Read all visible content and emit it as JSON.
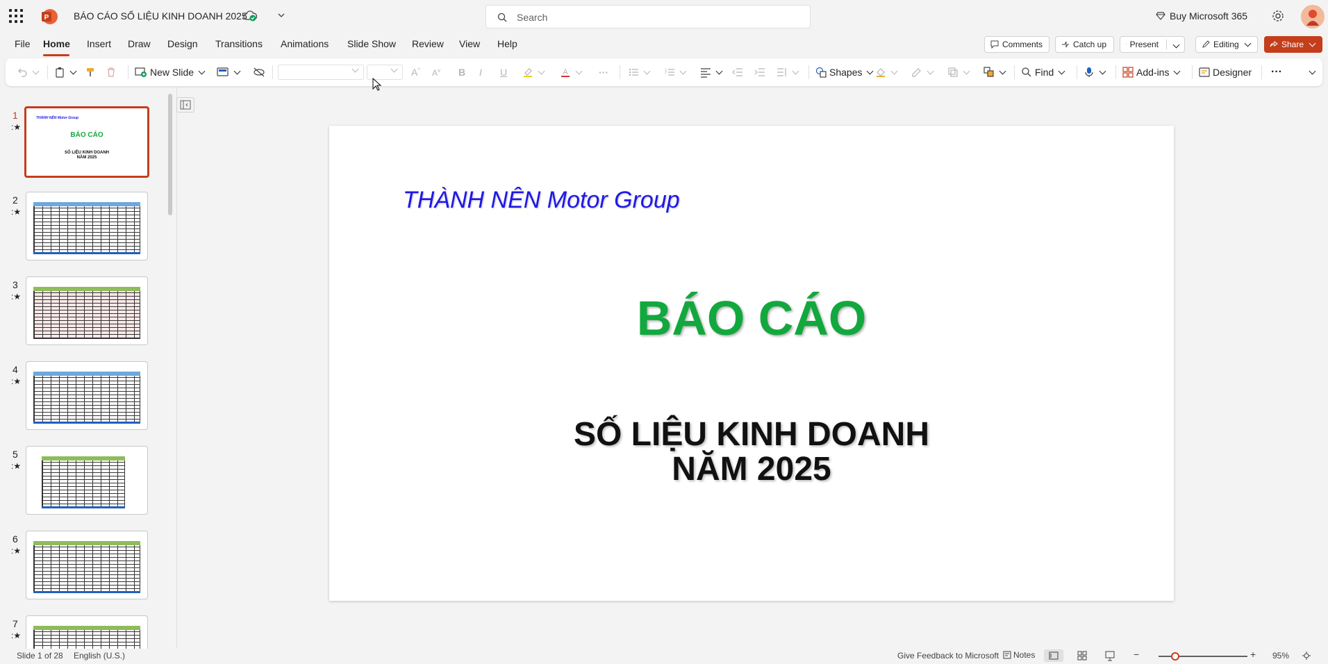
{
  "titlebar": {
    "doc_title": "BÁO CÁO SỐ LIỆU KINH DOANH 2025",
    "search_placeholder": "Search",
    "buy_label": "Buy Microsoft 365",
    "app_icon": "powerpoint-logo-icon"
  },
  "menubar": {
    "tabs": [
      "File",
      "Home",
      "Insert",
      "Draw",
      "Design",
      "Transitions",
      "Animations",
      "Slide Show",
      "Review",
      "View",
      "Help"
    ],
    "active_tab": "Home",
    "comments_label": "Comments",
    "catchup_label": "Catch up",
    "present_label": "Present",
    "editing_label": "Editing",
    "share_label": "Share"
  },
  "ribbon": {
    "new_slide_label": "New Slide",
    "shapes_label": "Shapes",
    "find_label": "Find",
    "addins_label": "Add-ins",
    "designer_label": "Designer"
  },
  "thumbnails": {
    "numbers": [
      "1",
      "2",
      "3",
      "4",
      "5",
      "6",
      "7"
    ],
    "slide1_company": "THÀNH NÊN Motor Group",
    "slide1_title": "BÁO CÁO",
    "slide1_sub1": "SỐ LIỆU KINH DOANH",
    "slide1_sub2": "NĂM 2025"
  },
  "slide": {
    "company": "THÀNH NÊN Motor Group",
    "title": "BÁO CÁO",
    "subtitle_line1": "SỐ LIỆU KINH DOANH",
    "subtitle_line2": "NĂM 2025"
  },
  "statusbar": {
    "slide_info": "Slide 1 of 28",
    "language": "English (U.S.)",
    "feedback": "Give Feedback to Microsoft",
    "notes": "Notes",
    "zoom": "95%"
  },
  "colors": {
    "accent": "#c43e1c",
    "company_text": "#1f17e8",
    "title_green": "#12a83e"
  }
}
